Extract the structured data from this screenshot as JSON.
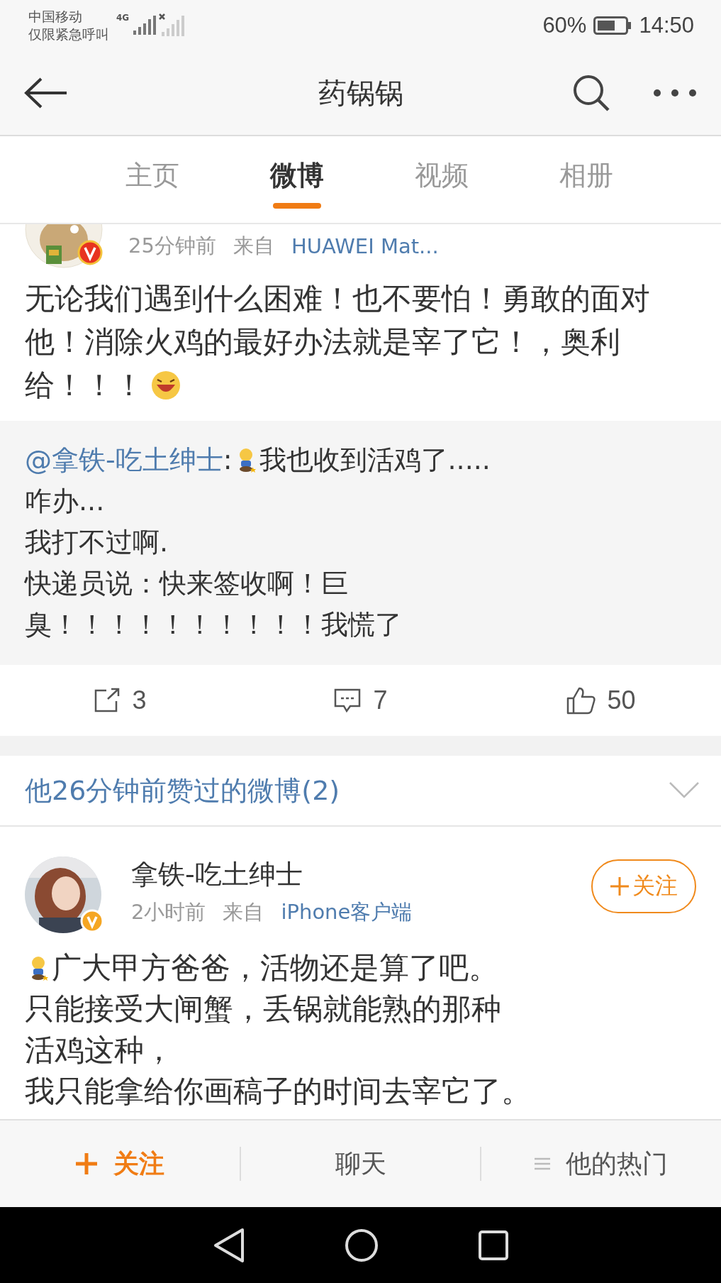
{
  "status_bar": {
    "carrier": "中国移动",
    "carrier_note": "仅限紧急呼叫",
    "network": "4G",
    "battery": "60%",
    "time": "14:50"
  },
  "header": {
    "title": "药锅锅"
  },
  "tabs": [
    {
      "label": "主页",
      "selected": false
    },
    {
      "label": "微博",
      "selected": true
    },
    {
      "label": "视频",
      "selected": false
    },
    {
      "label": "相册",
      "selected": false
    }
  ],
  "post": {
    "time": "25分钟前",
    "source_prefix": "来自",
    "source": "HUAWEI Mat...",
    "lines": [
      "无论我们遇到什么困难！也不要怕！勇敢的面对",
      "他！消除火鸡的最好办法就是宰了它！，奥利",
      "给！！！"
    ],
    "repost": {
      "mention": "@拿铁-吃土绅士",
      "separator": ":",
      "lines": [
        "我也收到活鸡了.....",
        "咋办...",
        "我打不过啊.",
        "快递员说：快来签收啊！巨",
        "臭！！！！！！！！！！我慌了"
      ]
    },
    "actions": [
      {
        "kind": "repost",
        "count": "3"
      },
      {
        "kind": "comment",
        "count": "7"
      },
      {
        "kind": "like",
        "count": "50"
      }
    ]
  },
  "liked_section": {
    "title": "他26分钟前赞过的微博(2)",
    "expanded": false
  },
  "liked_post": {
    "author": "拿铁-吃土绅士",
    "time": "2小时前",
    "source_prefix": "来自",
    "source": "iPhone客户端",
    "follow_label": "关注",
    "lines": [
      "广大甲方爸爸，活物还是算了吧。",
      "只能接受大闸蟹，丢锅就能熟的那种",
      "活鸡这种，",
      "我只能拿给你画稿子的时间去宰它了。"
    ]
  },
  "bottom_bar": [
    {
      "kind": "follow",
      "label": "关注"
    },
    {
      "kind": "chat",
      "label": "聊天"
    },
    {
      "kind": "hot",
      "label": "他的热门"
    }
  ]
}
